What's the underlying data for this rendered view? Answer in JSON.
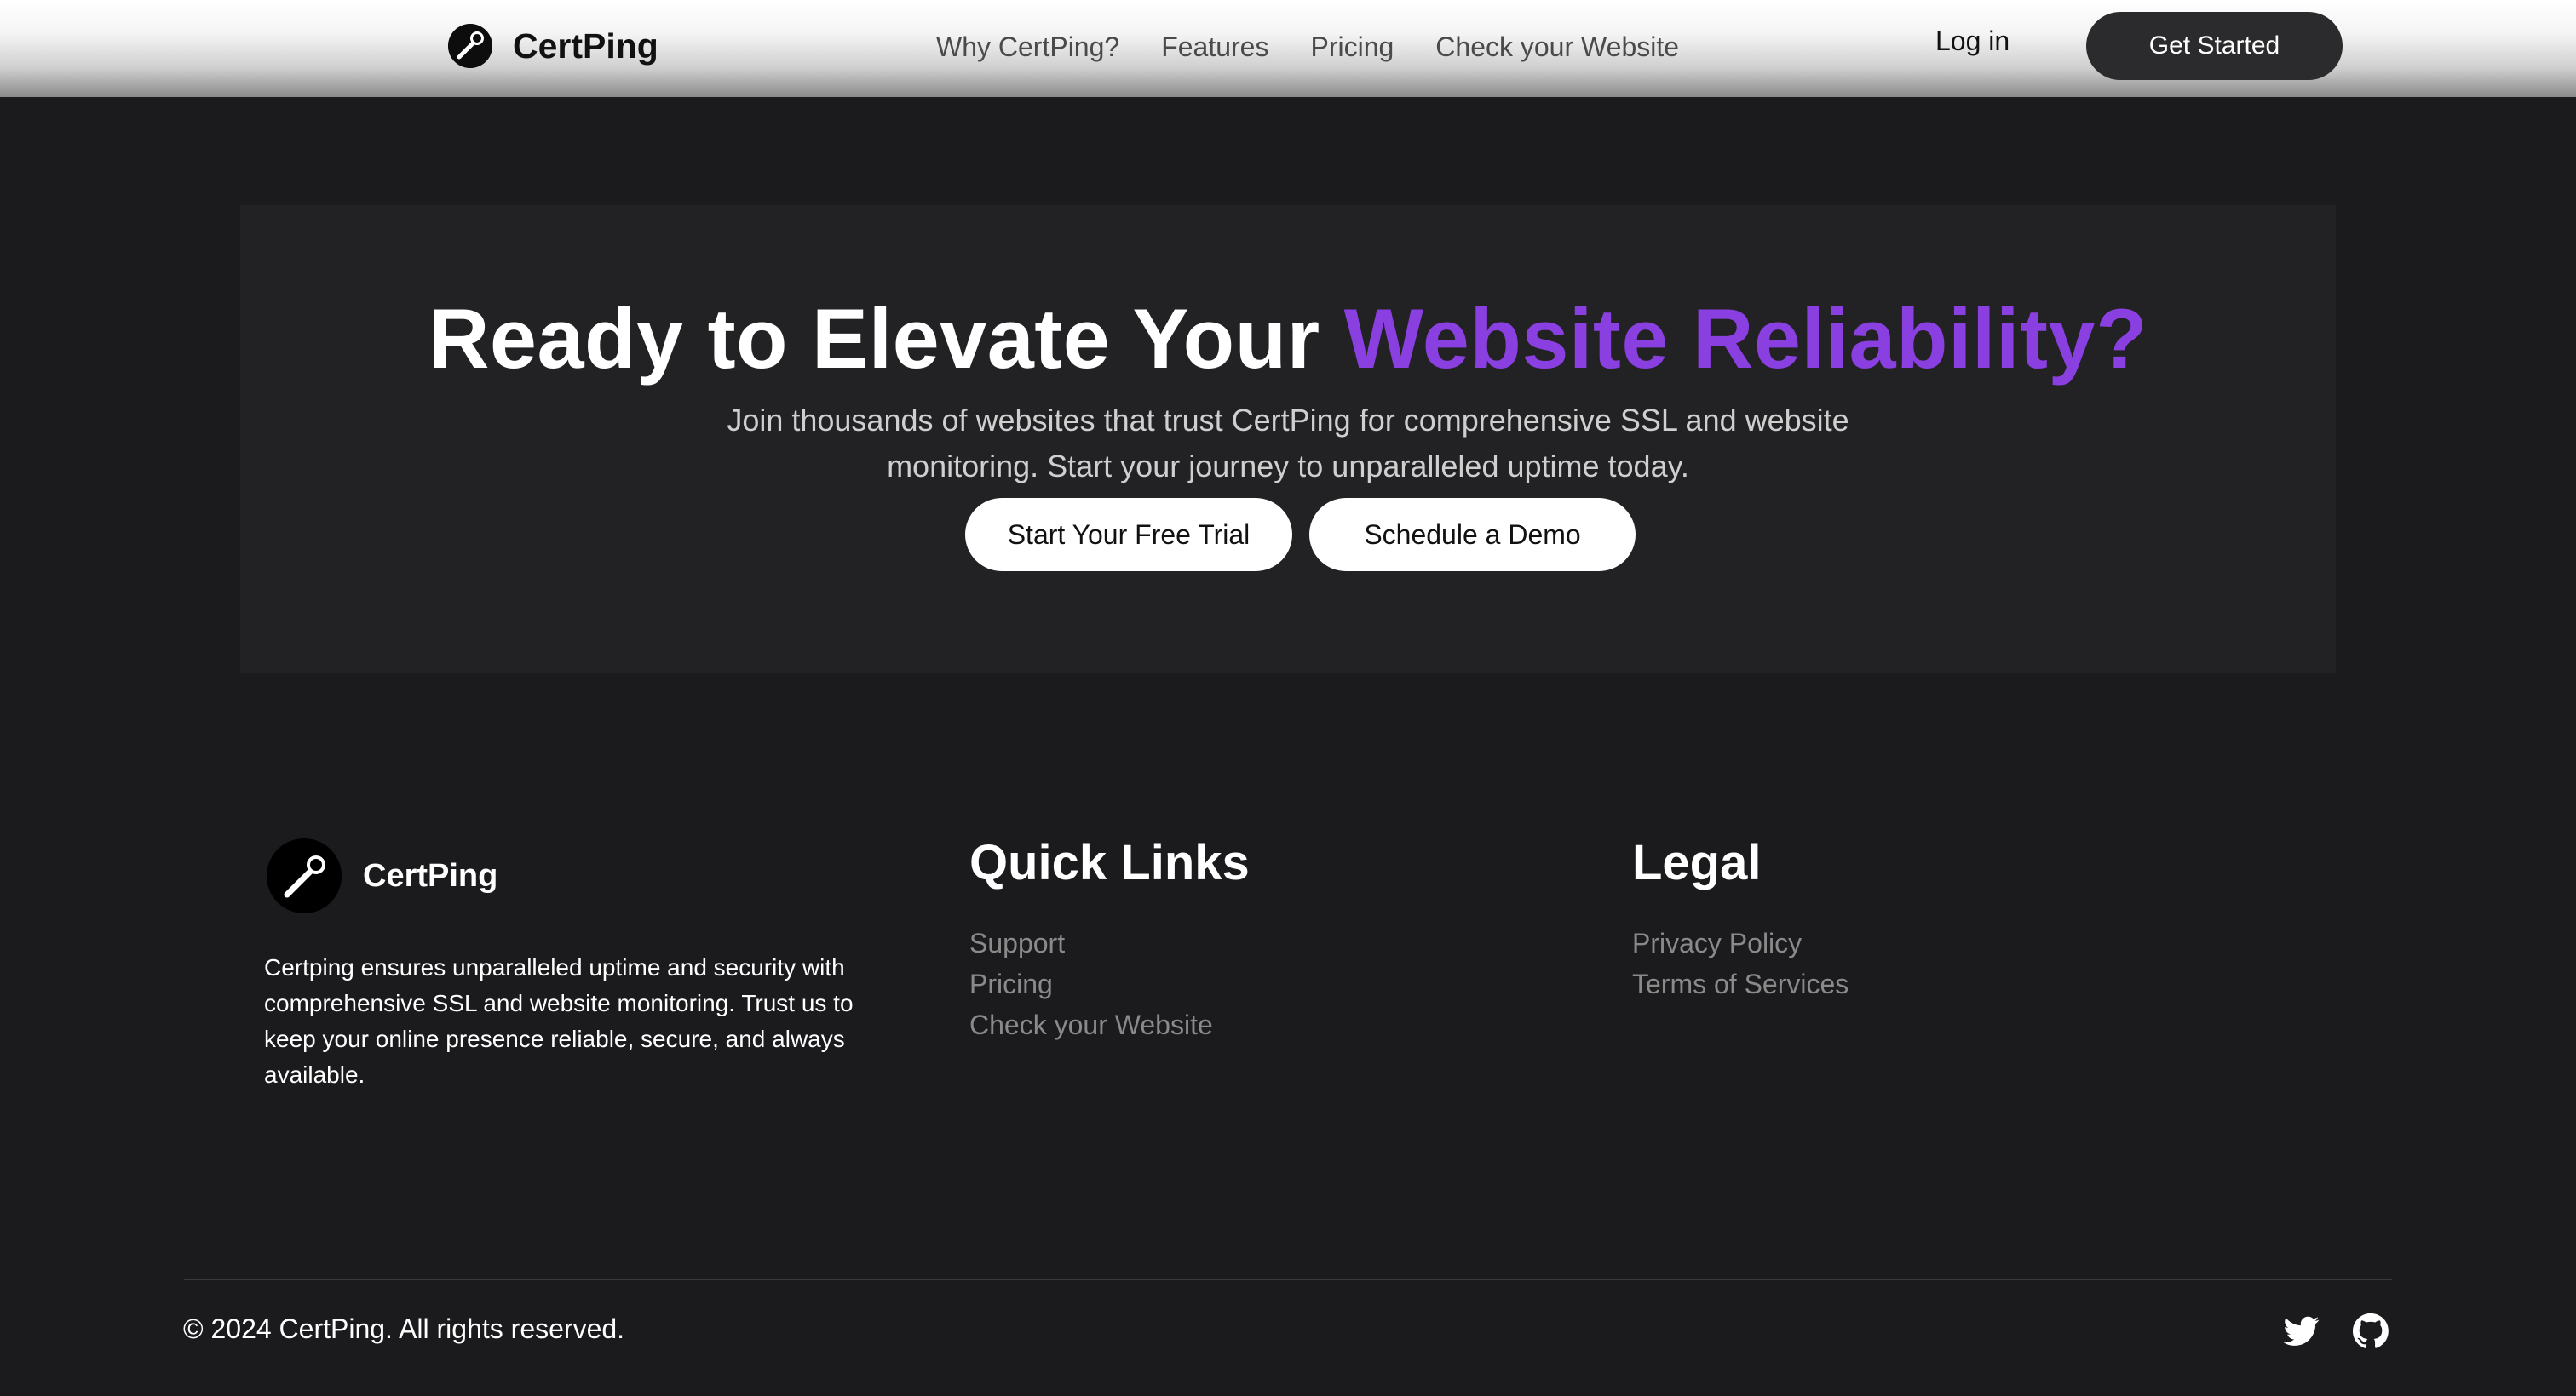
{
  "header": {
    "brand_name": "CertPing",
    "nav": [
      {
        "label": "Why CertPing?"
      },
      {
        "label": "Features"
      },
      {
        "label": "Pricing"
      },
      {
        "label": "Check your Website"
      }
    ],
    "login_label": "Log in",
    "cta_label": "Get Started"
  },
  "hero": {
    "title_main": "Ready to Elevate Your ",
    "title_accent": "Website Reliability?",
    "subtitle": "Join thousands of websites that trust CertPing for comprehensive SSL and website monitoring. Start your journey to unparalleled uptime today.",
    "primary_button": "Start Your Free Trial",
    "secondary_button": "Schedule a Demo"
  },
  "footer": {
    "brand_name": "CertPing",
    "about": "Certping ensures unparalleled uptime and security with comprehensive SSL and website monitoring. Trust us to keep your online presence reliable, secure, and always available.",
    "quick_links": {
      "title": "Quick Links",
      "items": [
        {
          "label": "Support"
        },
        {
          "label": "Pricing"
        },
        {
          "label": "Check your Website"
        }
      ]
    },
    "legal": {
      "title": "Legal",
      "items": [
        {
          "label": "Privacy Policy"
        },
        {
          "label": "Terms of Services"
        }
      ]
    },
    "copyright": "© 2024 CertPing. All rights reserved.",
    "social": [
      {
        "icon": "twitter-icon"
      },
      {
        "icon": "github-icon"
      }
    ]
  },
  "colors": {
    "accent": "#8a3fe0",
    "background": "#1b1b1d",
    "card": "#222224",
    "link_muted": "#8a8a8a"
  }
}
